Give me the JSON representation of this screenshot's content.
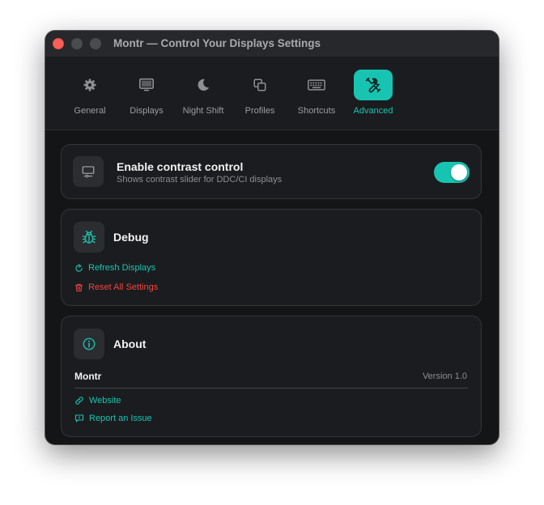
{
  "window": {
    "title": "Montr — Control Your Displays Settings"
  },
  "tabs": [
    {
      "label": "General",
      "icon": "gear-icon"
    },
    {
      "label": "Displays",
      "icon": "monitor-icon"
    },
    {
      "label": "Night Shift",
      "icon": "moon-icon"
    },
    {
      "label": "Profiles",
      "icon": "copy-icon"
    },
    {
      "label": "Shortcuts",
      "icon": "keyboard-icon"
    },
    {
      "label": "Advanced",
      "icon": "tools-icon",
      "active": true
    }
  ],
  "contrast": {
    "title": "Enable contrast control",
    "subtitle": "Shows contrast slider for DDC/CI displays",
    "enabled": true
  },
  "debug": {
    "title": "Debug",
    "refresh_label": "Refresh Displays",
    "reset_label": "Reset All Settings"
  },
  "about": {
    "title": "About",
    "app_name": "Montr",
    "version": "Version 1.0",
    "website_label": "Website",
    "report_label": "Report an Issue"
  },
  "colors": {
    "accent": "#17c4b2",
    "danger": "#f1453d",
    "background": "#141517",
    "card": "#1b1c1f"
  }
}
